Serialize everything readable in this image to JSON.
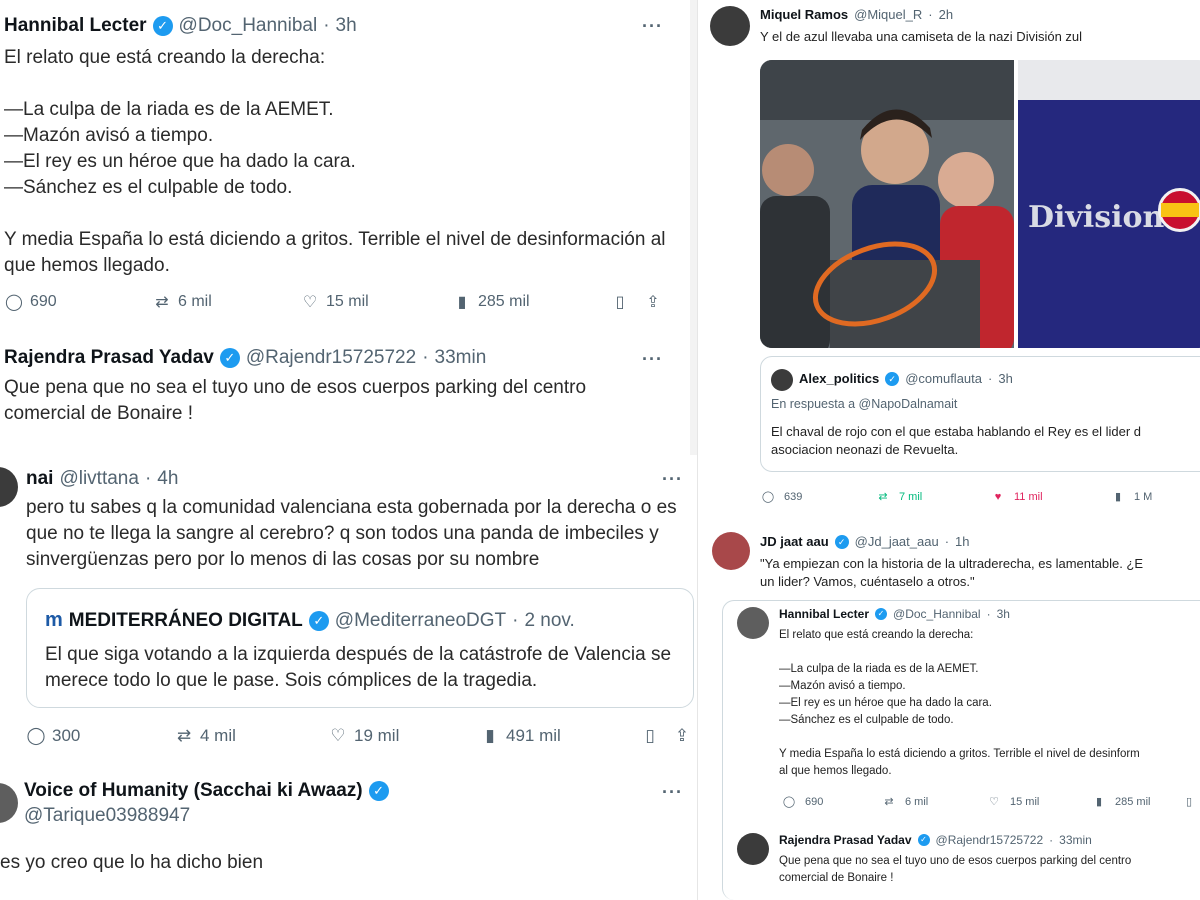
{
  "top_left": {
    "name": "Hannibal Lecter",
    "handle": "@Doc_Hannibal",
    "time": "3h",
    "text": "El relato que está creando la derecha:\n\n—La culpa de la riada es de la AEMET.\n—Mazón avisó a tiempo.\n—El rey es un héroe que ha dado la cara.\n—Sánchez es el culpable de todo.\n\nY media España lo está diciendo a gritos. Terrible el nivel de desinformación al que hemos llegado.",
    "stats": {
      "replies": "690",
      "retweets": "6 mil",
      "likes": "15 mil",
      "views": "285 mil"
    },
    "reply": {
      "name": "Rajendra Prasad Yadav",
      "handle": "@Rajendr15725722",
      "time": "33min",
      "text": "Que pena que no sea el tuyo uno de esos cuerpos parking del centro comercial de Bonaire !"
    }
  },
  "bottom_left": {
    "name": "nai",
    "handle": "@livttana",
    "time": "4h",
    "text": "pero tu sabes q la comunidad valenciana esta gobernada por la derecha o es que no te llega la sangre al cerebro? q son todos una panda de imbeciles y sinvergüenzas pero por lo menos di las cosas por su nombre",
    "quote": {
      "logo": "m",
      "name": "MEDITERRÁNEO DIGITAL",
      "handle": "@MediterraneoDGT",
      "time": "2 nov.",
      "text": "El que siga votando a la izquierda después de la catástrofe de Valencia se merece todo lo que le pase. Sois cómplices de la tragedia."
    },
    "stats": {
      "replies": "300",
      "retweets": "4 mil",
      "likes": "19 mil",
      "views": "491 mil"
    },
    "next": {
      "name": "Voice of Humanity (Sacchai ki Awaaz)",
      "handle": "@Tarique03988947",
      "text": "es yo creo que lo ha dicho bien"
    }
  },
  "right": {
    "name": "Miquel Ramos",
    "handle": "@Miquel_R",
    "time": "2h",
    "text": "Y el de azul llevaba una camiseta de la nazi División zul",
    "shirt_print": "Division",
    "quote": {
      "name": "Alex_politics",
      "handle": "@comuflauta",
      "time": "3h",
      "reply_to": "En respuesta a @NapoDalnamait",
      "text": "El chaval de rojo con el que estaba hablando el Rey es el lider d\nasociacion neonazi de Revuelta."
    },
    "stats": {
      "replies": "639",
      "retweets": "7 mil",
      "likes": "11 mil",
      "views": "1 M"
    },
    "reply": {
      "name": "JD jaat aau",
      "handle": "@Jd_jaat_aau",
      "time": "1h",
      "text": "\"Ya empiezan con la historia de la ultraderecha, es lamentable. ¿E\nun lider? Vamos, cuéntaselo a otros.\""
    },
    "mini": {
      "name": "Hannibal Lecter",
      "handle": "@Doc_Hannibal",
      "time": "3h",
      "text": "El relato que está creando la derecha:\n\n—La culpa de la riada es de la AEMET.\n—Mazón avisó a tiempo.\n—El rey es un héroe que ha dado la cara.\n—Sánchez es el culpable de todo.\n\nY media España lo está diciendo a gritos. Terrible el nivel de desinform\nal que hemos llegado.",
      "stats": {
        "replies": "690",
        "retweets": "6 mil",
        "likes": "15 mil",
        "views": "285 mil"
      }
    },
    "mini_reply": {
      "name": "Rajendra Prasad Yadav",
      "handle": "@Rajendr15725722",
      "time": "33min",
      "text": "Que pena que no sea el tuyo uno de esos cuerpos parking del centro\ncomercial de Bonaire !"
    }
  },
  "icons": {
    "verified": "✓",
    "more": "···",
    "reply": "◯",
    "retweet": "⇄",
    "like": "♡",
    "like_filled": "♥",
    "views": "▮",
    "bookmark": "▯",
    "share": "⇪",
    "dot": "·"
  }
}
